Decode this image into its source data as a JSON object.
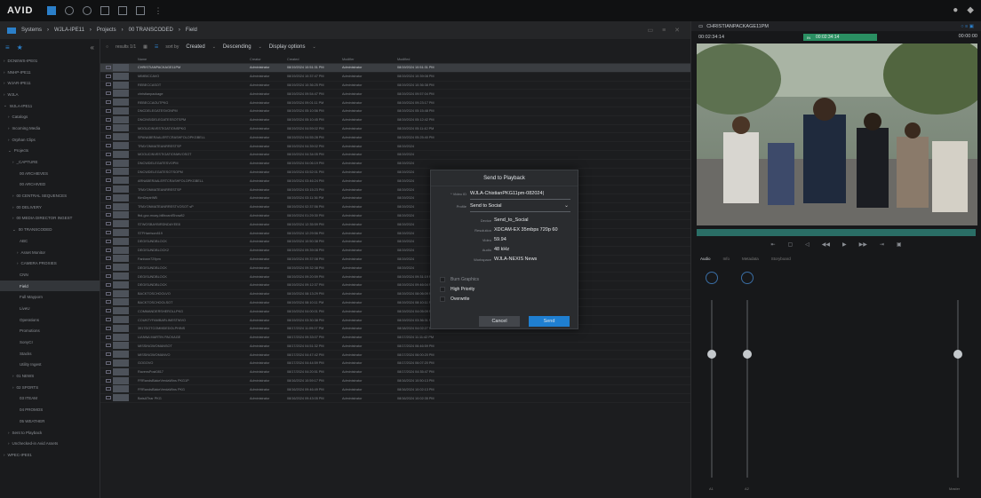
{
  "app": {
    "logo": "AVID"
  },
  "breadcrumb": [
    "Systems",
    "WJLA-IPE11",
    "Projects",
    "00 TRANSCODED",
    "Field"
  ],
  "sidebar": {
    "items": [
      {
        "label": "DCNEWS-IPE01",
        "indent": 0,
        "prefix": "›"
      },
      {
        "label": "NNHP-IPE11",
        "indent": 0,
        "prefix": "›"
      },
      {
        "label": "WJAR-IPE11",
        "indent": 0,
        "prefix": "›"
      },
      {
        "label": "WJLA",
        "indent": 0,
        "prefix": "›"
      },
      {
        "label": "WJLA-IPE11",
        "indent": 0,
        "prefix": "⌄"
      },
      {
        "label": "Catalogs",
        "indent": 1,
        "prefix": "›"
      },
      {
        "label": "Incoming Media",
        "indent": 1,
        "prefix": "›"
      },
      {
        "label": "Orphan Clips",
        "indent": 1,
        "prefix": "›"
      },
      {
        "label": "Projects",
        "indent": 1,
        "prefix": "⌄"
      },
      {
        "label": "_CAPTURE",
        "indent": 2,
        "prefix": "›"
      },
      {
        "label": "00 ARCHIEVES",
        "indent": 3,
        "prefix": ""
      },
      {
        "label": "00 ARCHIVED",
        "indent": 3,
        "prefix": ""
      },
      {
        "label": "00 CENTRAL SEQUENCES",
        "indent": 2,
        "prefix": "›"
      },
      {
        "label": "00 DELIVERY",
        "indent": 2,
        "prefix": "›"
      },
      {
        "label": "00 MEDIA DIRECTOR INGEST",
        "indent": 2,
        "prefix": "›"
      },
      {
        "label": "00 TRANSCODED",
        "indent": 2,
        "prefix": "⌄"
      },
      {
        "label": "ABC",
        "indent": 3,
        "prefix": ""
      },
      {
        "label": "Asset Monitor",
        "indent": 3,
        "prefix": "›"
      },
      {
        "label": "CAMERA PROXIES",
        "indent": 3,
        "prefix": "›"
      },
      {
        "label": "CNN",
        "indent": 3,
        "prefix": ""
      },
      {
        "label": "Field",
        "indent": 3,
        "prefix": "",
        "selected": true
      },
      {
        "label": "Full Mayporn",
        "indent": 3,
        "prefix": ""
      },
      {
        "label": "LiveU",
        "indent": 3,
        "prefix": ""
      },
      {
        "label": "Operations",
        "indent": 3,
        "prefix": ""
      },
      {
        "label": "Promotions",
        "indent": 3,
        "prefix": ""
      },
      {
        "label": "SonyCI",
        "indent": 3,
        "prefix": ""
      },
      {
        "label": "Stacks",
        "indent": 3,
        "prefix": ""
      },
      {
        "label": "Utility Ingest",
        "indent": 3,
        "prefix": ""
      },
      {
        "label": "01 NEWS",
        "indent": 2,
        "prefix": "›"
      },
      {
        "label": "02 SPORTS",
        "indent": 2,
        "prefix": "›"
      },
      {
        "label": "03 ITEAM",
        "indent": 3,
        "prefix": ""
      },
      {
        "label": "04 PROMOS",
        "indent": 3,
        "prefix": ""
      },
      {
        "label": "05 WEATHER",
        "indent": 3,
        "prefix": ""
      },
      {
        "label": "Sent to Playback",
        "indent": 1,
        "prefix": "›"
      },
      {
        "label": "Unchecked-in Avid Assets",
        "indent": 1,
        "prefix": "›"
      },
      {
        "label": "WPEC-IPE01",
        "indent": 0,
        "prefix": "›"
      }
    ]
  },
  "toolbar": {
    "results": "results 1/1",
    "sort_by_label": "sort by",
    "sort_by": "Created",
    "order": "Descending",
    "display": "Display options"
  },
  "columns": {
    "name": "Name",
    "creator": "Creator",
    "created": "Created",
    "modifier": "Modifier",
    "modified": "Modified"
  },
  "rows": [
    {
      "name": "CHRISTIANPACKAGE11PM",
      "creator": "Administrator",
      "created": "08/19/2024 10:51:31 PM",
      "modifier": "Administrator",
      "modified": "08/19/2024 10:51:31 PM",
      "selected": true
    },
    {
      "name": "MIMBICCAVO",
      "creator": "Administrator",
      "created": "08/19/2024 10:37:47 PM",
      "modifier": "Administrator",
      "modified": "08/19/2024 10:39:08 PM"
    },
    {
      "name": "REBECCASOT",
      "creator": "Administrator",
      "created": "08/19/2024 10:36:25 PM",
      "modifier": "Administrator",
      "modified": "08/19/2024 10:36:38 PM"
    },
    {
      "name": "christianpackage",
      "creator": "Administrator",
      "created": "08/19/2024 09:54:47 PM",
      "modifier": "Administrator",
      "modified": "08/19/2024 09:57:04 PM"
    },
    {
      "name": "REBECCAOUTPKG",
      "creator": "Administrator",
      "created": "08/19/2024 09:01:11 PM",
      "modifier": "Administrator",
      "modified": "08/19/2024 09:23:17 PM"
    },
    {
      "name": "DNCDELEGATESVONPM",
      "creator": "Administrator",
      "created": "08/19/2024 05:10:56 PM",
      "modifier": "Administrator",
      "modified": "08/19/2024 05:15:48 PM"
    },
    {
      "name": "DNCINSIDELEGATESSOTSPM",
      "creator": "Administrator",
      "created": "08/19/2024 05:10:45 PM",
      "modifier": "Administrator",
      "modified": "08/19/2024 05:12:42 PM"
    },
    {
      "name": "MOOUCINVESTIGATIONSPKG",
      "creator": "Administrator",
      "created": "08/19/2024 04:59:02 PM",
      "modifier": "Administrator",
      "modified": "08/19/2024 05:11:42 PM"
    },
    {
      "name": "SPANABERAALERTCRASHFOLOPKGBELL",
      "creator": "Administrator",
      "created": "08/19/2024 04:55:28 PM",
      "modifier": "Administrator",
      "modified": "08/19/2024 05:25:40 PM"
    },
    {
      "name": "TRAYONMATEANRRESTSP",
      "creator": "Administrator",
      "created": "08/19/2024 04:39:02 PM",
      "modifier": "Administrator",
      "modified": "08/19/2024"
    },
    {
      "name": "MOOUCINVESTIGATIONWVOSOT",
      "creator": "Administrator",
      "created": "08/19/2024 04:34:05 PM",
      "modifier": "Administrator",
      "modified": "08/19/2024"
    },
    {
      "name": "DNCWDELEGATESVOPM",
      "creator": "Administrator",
      "created": "08/19/2024 04:06:19 PM",
      "modifier": "Administrator",
      "modified": "08/19/2024"
    },
    {
      "name": "DNCWDELEGATESOTSOPM",
      "creator": "Administrator",
      "created": "08/19/2024 03:52:01 PM",
      "modifier": "Administrator",
      "modified": "08/19/2024"
    },
    {
      "name": "ARNABERAALERTCRASHFOLOPKGBELL",
      "creator": "Administrator",
      "created": "08/19/2024 03:46:24 PM",
      "modifier": "Administrator",
      "modified": "08/19/2024"
    },
    {
      "name": "TRAYONMATEANRRESTSP",
      "creator": "Administrator",
      "created": "08/19/2024 03:15:23 PM",
      "modifier": "Administrator",
      "modified": "08/19/2024"
    },
    {
      "name": "KimDeptrWB",
      "creator": "Administrator",
      "created": "08/19/2024 03:11:36 PM",
      "modifier": "Administrator",
      "modified": "08/19/2024"
    },
    {
      "name": "TRAYONMATEANRRESTVOSOT sP",
      "creator": "Administrator",
      "created": "08/19/2024 02:37:56 PM",
      "modifier": "Administrator",
      "modified": "08/19/2024"
    },
    {
      "name": "fbd-gov-moay-billboardShow82",
      "creator": "Administrator",
      "created": "08/19/2024 01:29:30 PM",
      "modifier": "Administrator",
      "modified": "08/19/2024"
    },
    {
      "name": "STWOSBAYBIRDNDAYEE8",
      "creator": "Administrator",
      "created": "08/19/2024 12:35:59 PM",
      "modifier": "Administrator",
      "modified": "08/19/2024"
    },
    {
      "name": "STFHarrison819",
      "creator": "Administrator",
      "created": "08/19/2024 12:29:56 PM",
      "modifier": "Administrator",
      "modified": "08/19/2024"
    },
    {
      "name": "DEGISUNDBLOCK",
      "creator": "Administrator",
      "created": "08/19/2024 10:50:38 PM",
      "modifier": "Administrator",
      "modified": "08/19/2024"
    },
    {
      "name": "DEGISUNDBLOCK2",
      "creator": "Administrator",
      "created": "08/19/2024 09:39:08 PM",
      "modifier": "Administrator",
      "modified": "08/19/2024"
    },
    {
      "name": "Fanbanr729pm",
      "creator": "Administrator",
      "created": "08/19/2024 09:37:08 PM",
      "modifier": "Administrator",
      "modified": "08/19/2024"
    },
    {
      "name": "DEGISUNDBLOCK",
      "creator": "Administrator",
      "created": "08/19/2024 09:32:38 PM",
      "modifier": "Administrator",
      "modified": "08/19/2024"
    },
    {
      "name": "DEGISUNDBLOCK",
      "creator": "Administrator",
      "created": "08/19/2024 09:20:59 PM",
      "modifier": "Administrator",
      "modified": "08/19/2024 09:31:19 PM"
    },
    {
      "name": "DEGISUNDBLOCK",
      "creator": "Administrator",
      "created": "08/19/2024 09:12:37 PM",
      "modifier": "Administrator",
      "modified": "08/19/2024 09:46:04 PM"
    },
    {
      "name": "BACKTOSCHOOLVO",
      "creator": "Administrator",
      "created": "08/19/2024 08:13:29 PM",
      "modifier": "Administrator",
      "modified": "08/19/2024 08:06:09 PM"
    },
    {
      "name": "BACKTOSCHOOLSOT",
      "creator": "Administrator",
      "created": "08/19/2024 08:10:11 PM",
      "modifier": "Administrator",
      "modified": "08/19/2024 08:10:11 PM"
    },
    {
      "name": "COMMANDERSHEROLLPKG",
      "creator": "Administrator",
      "created": "08/19/2024 04:00:01 PM",
      "modifier": "Administrator",
      "modified": "08/19/2024 04:05:09 PM"
    },
    {
      "name": "COUNTYFAMBARLINESTWVO",
      "creator": "Administrator",
      "created": "08/19/2024 03:30:38 PM",
      "modifier": "Administrator",
      "modified": "08/19/2024 03:36:31 PM"
    },
    {
      "name": "3917DOTCOMMDEDOLPHINS",
      "creator": "Administrator",
      "created": "08/17/2024 11:09:07 PM",
      "modifier": "Administrator",
      "modified": "08/18/2024 04:02:27 PM"
    },
    {
      "name": "LIANNA MARTIN PACKAGE",
      "creator": "Administrator",
      "created": "08/17/2024 09:33:07 PM",
      "modifier": "Administrator",
      "modified": "08/17/2024 11:11:42 PM"
    },
    {
      "name": "MISSINGWOMANSOT",
      "creator": "Administrator",
      "created": "08/17/2024 04:51:32 PM",
      "modifier": "Administrator",
      "modified": "08/17/2024 06:46:59 PM"
    },
    {
      "name": "MISSINGWOMANVO",
      "creator": "Administrator",
      "created": "08/17/2024 04:47:42 PM",
      "modifier": "Administrator",
      "modified": "08/17/2024 06:00:20 PM"
    },
    {
      "name": "GOGOVO",
      "creator": "Administrator",
      "created": "08/17/2024 04:44:59 PM",
      "modifier": "Administrator",
      "modified": "08/17/2024 06:07:20 PM"
    },
    {
      "name": "RavensPost0817",
      "creator": "Administrator",
      "created": "08/17/2024 04:20:51 PM",
      "modifier": "Administrator",
      "modified": "08/17/2024 04:35:47 PM"
    },
    {
      "name": "FRRandsBlakeVerdaWins PKG1P",
      "creator": "Administrator",
      "created": "08/16/2024 10:59:17 PM",
      "modifier": "Administrator",
      "modified": "08/16/2024 10:50:13 PM"
    },
    {
      "name": "FRRandsBlakeVerdaWins PKG",
      "creator": "Administrator",
      "created": "08/16/2024 09:46:49 PM",
      "modifier": "Administrator",
      "modified": "08/16/2024 10:02:13 PM"
    },
    {
      "name": "BatsAThar PKG",
      "creator": "Administrator",
      "created": "08/16/2024 09:43:05 PM",
      "modifier": "Administrator",
      "modified": "08/16/2024 10:02:35 PM"
    }
  ],
  "player": {
    "title": "CHRISTIANPACKAGE11PM",
    "tc_in": "00:02:34:14",
    "tc_center": "00:02:34:14",
    "tc_center_label": "IN",
    "tc_right": "00:00:00"
  },
  "audio_tabs": [
    "Audio",
    "Info",
    "Metadata",
    "Storyboard"
  ],
  "mixer": {
    "labels": [
      "A1",
      "A2",
      "Master"
    ]
  },
  "modal": {
    "title": "Send to Playback",
    "video_id_label": "* Video ID",
    "video_id": "WJLA-ChistianPKG11pm-082024|",
    "profile_label": "Profile",
    "profile": "Send to Social",
    "info": [
      {
        "label": "Device",
        "value": "Send_to_Social"
      },
      {
        "label": "Resolution",
        "value": "XDCAM-EX 35mbps 720p 60"
      },
      {
        "label": "Video",
        "value": "59.94"
      },
      {
        "label": "Audio",
        "value": "48 kHz"
      },
      {
        "label": "Workspace",
        "value": "WJLA-NEXIS News"
      }
    ],
    "options": [
      "Burn Graphics",
      "High Priority",
      "Overwrite"
    ],
    "cancel": "Cancel",
    "send": "Send"
  },
  "colors": {
    "accent": "#2b7fc9",
    "timecode_bg": "#2a8f62",
    "send_button": "#1f7fd1"
  }
}
